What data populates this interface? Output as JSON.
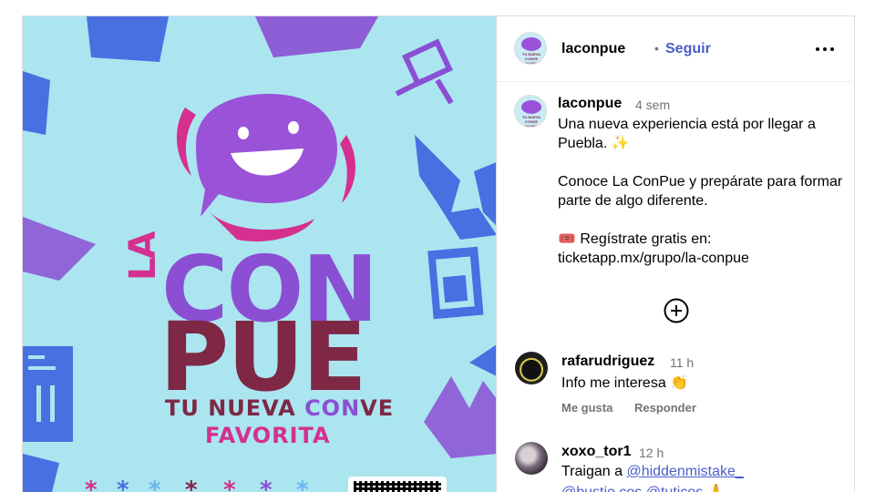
{
  "post": {
    "username": "laconpue",
    "follow_label": "Seguir",
    "separator": "•",
    "avatar_text": "TU NUEVA CONVE FAVORITA"
  },
  "poster": {
    "word_la": "LA",
    "word_con": "CON",
    "word_pue": "PUE",
    "tagline_part1": "TU NUEVA ",
    "tagline_accent": "CON",
    "tagline_part2": "VE",
    "tagline_line2": "FAVORITA",
    "colors": {
      "background": "#abe5f0",
      "purple": "#8b4fd3",
      "maroon": "#7e2846",
      "magenta": "#d52f90",
      "blue": "#4a6fe0"
    }
  },
  "caption": {
    "username": "laconpue",
    "time": "4 sem",
    "line1": "Una nueva experiencia está por llegar a Puebla. ✨",
    "line2": "Conoce La ConPue y prepárate para formar parte de algo diferente.",
    "line3_icon": "🎟️",
    "line3": " Regístrate gratis en:",
    "line4": "ticketapp.mx/grupo/la-conpue"
  },
  "comments": [
    {
      "username": "rafarudriguez",
      "time": "11 h",
      "text": "Info me interesa 👏",
      "like_label": "Me gusta",
      "reply_label": "Responder"
    },
    {
      "username": "xoxo_tor1",
      "time": "12 h",
      "text_prefix": "Traigan a ",
      "mention1": "@hiddenmistake_",
      "mention2": "@bustio.cos",
      "mention3": "@tuticos",
      "text_suffix": " 🙏"
    }
  ],
  "icons": {
    "more": "more-horizontal-icon",
    "add": "add-circle-icon"
  }
}
